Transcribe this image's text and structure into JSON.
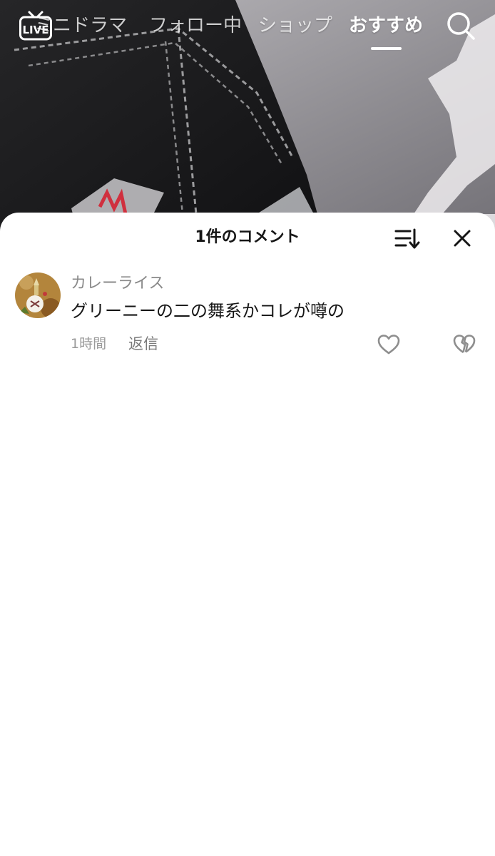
{
  "nav": {
    "live_label": "LIVE",
    "tabs": [
      {
        "label": "ミニドラマ"
      },
      {
        "label": "フォロー中"
      },
      {
        "label": "ショップ"
      },
      {
        "label": "おすすめ",
        "active": true
      }
    ],
    "search_icon": "search-icon"
  },
  "comments_panel": {
    "title": "1件のコメント",
    "sort_icon": "sort-icon",
    "close_icon": "close-icon",
    "comments": [
      {
        "username": "カレーライス",
        "text": "グリーニーの二の舞系かコレが噂の",
        "time": "1時間",
        "reply_label": "返信",
        "like_icon": "heart-outline-icon",
        "dislike_icon": "broken-heart-icon"
      }
    ]
  },
  "colors": {
    "sheet_background": "#ffffff",
    "primary_text": "#161616",
    "secondary_text": "#8a8a8a",
    "nav_active": "#ffffff"
  }
}
